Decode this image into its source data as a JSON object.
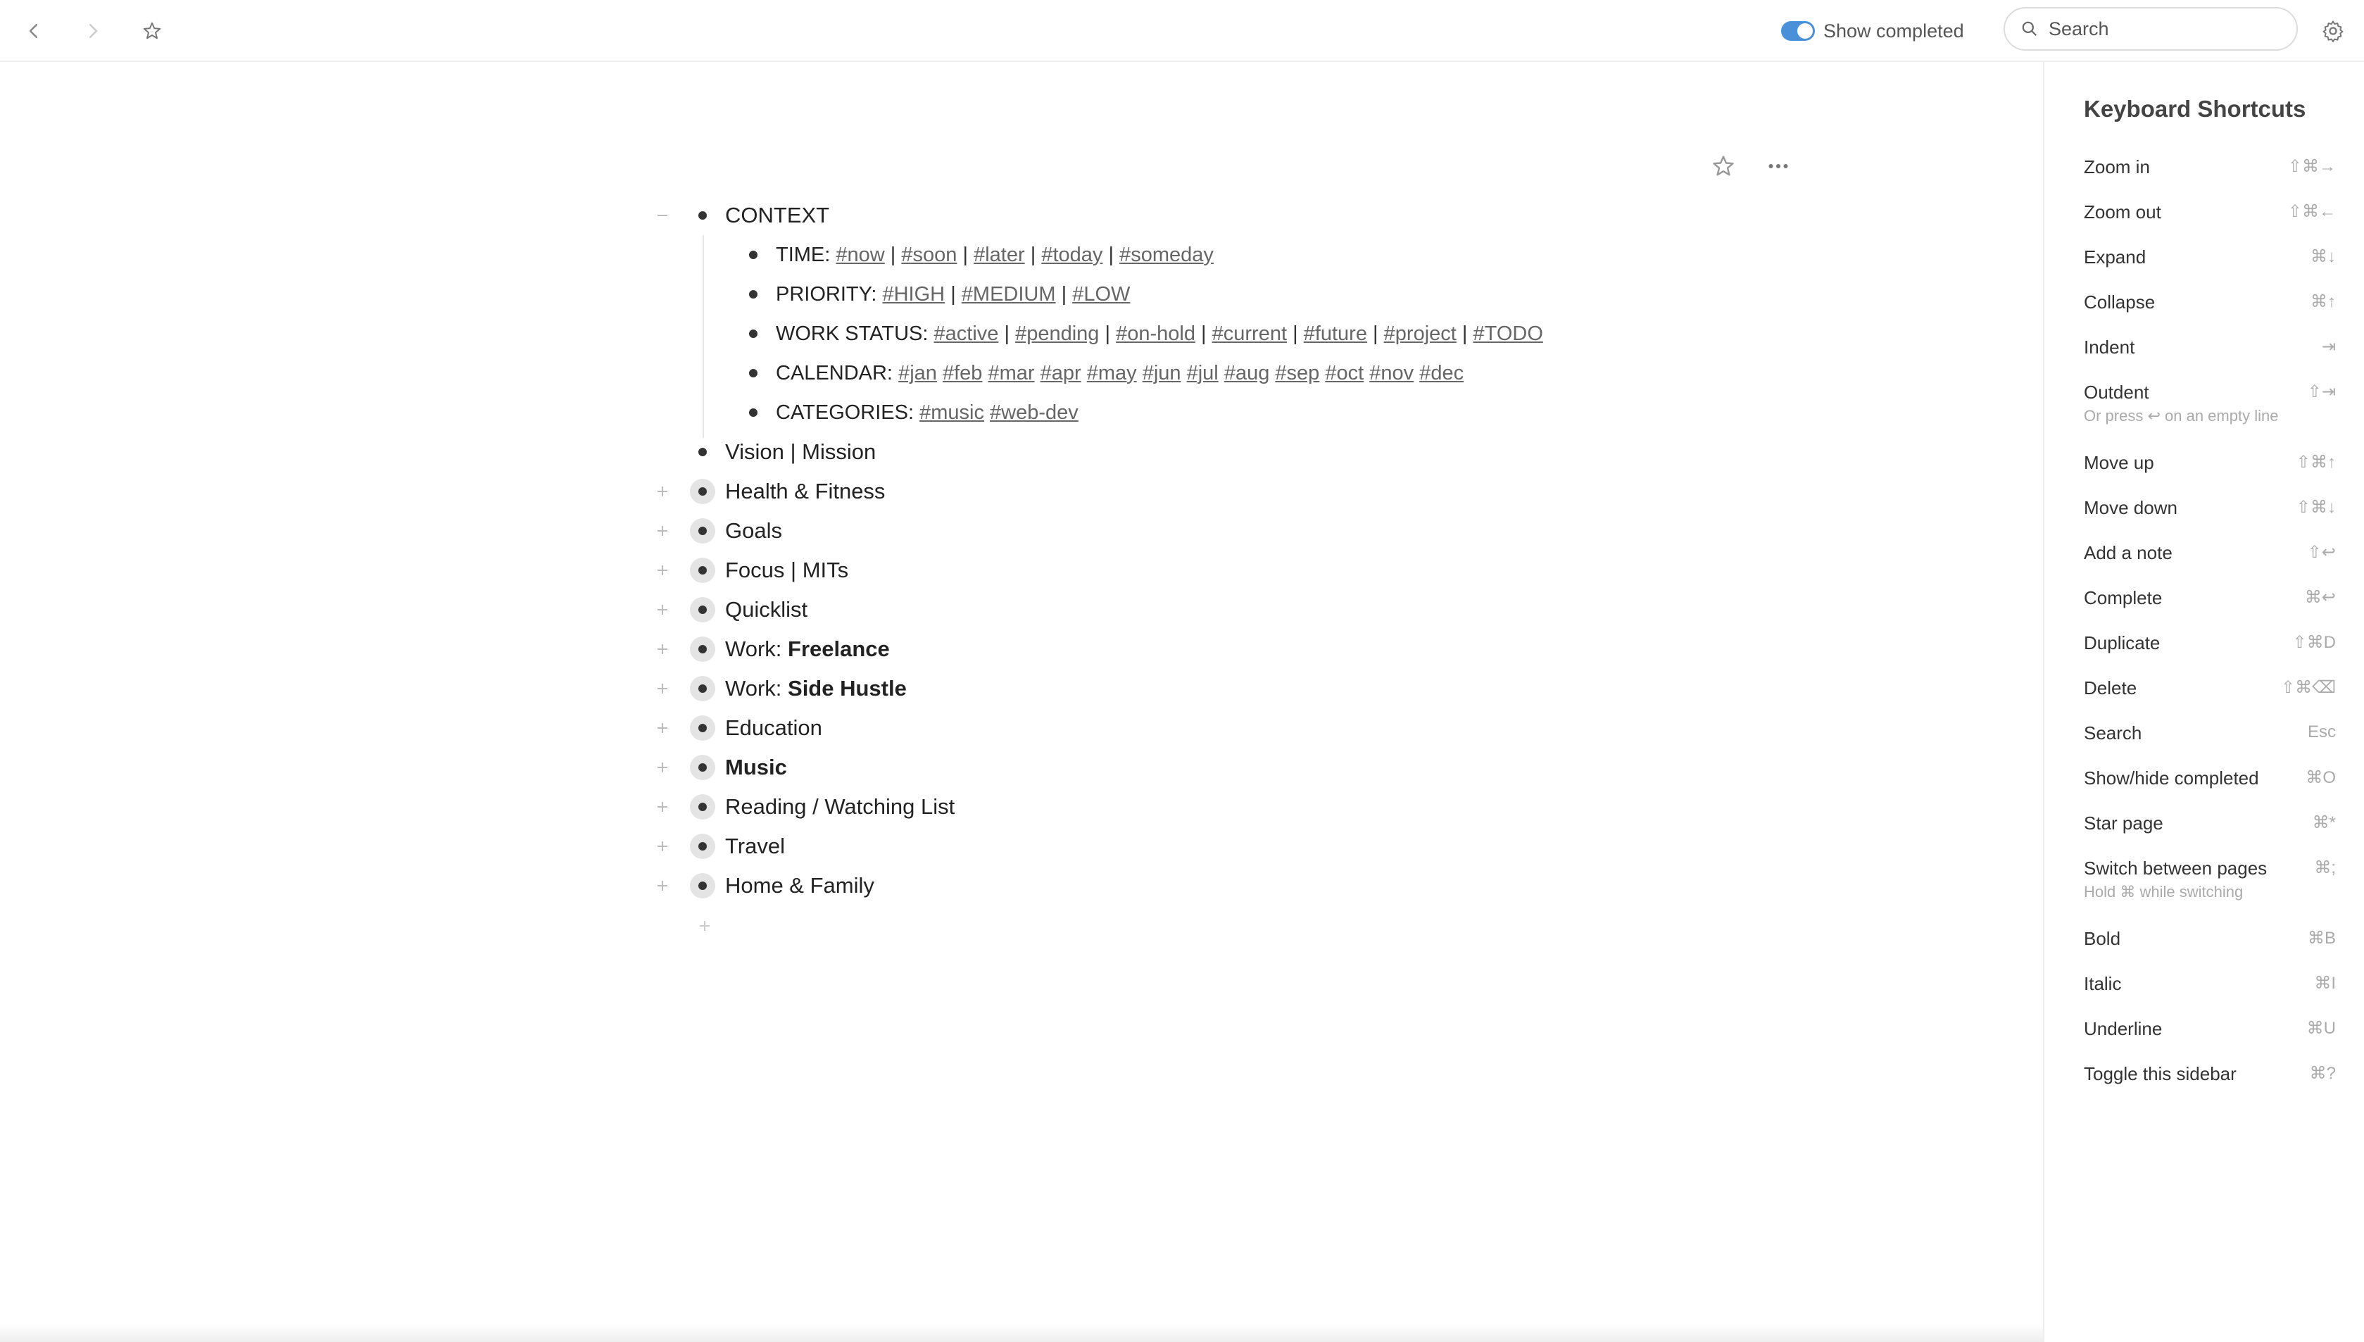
{
  "toolbar": {
    "show_completed_label": "Show completed",
    "show_completed_on": true,
    "search_placeholder": "Search",
    "accent_color": "#4a90d9"
  },
  "outline": {
    "context": {
      "title": "CONTEXT",
      "children": {
        "time": {
          "label": "TIME:",
          "tags": [
            "#now",
            "#soon",
            "#later",
            "#today",
            "#someday"
          ]
        },
        "priority": {
          "label": "PRIORITY:",
          "tags": [
            "#HIGH",
            "#MEDIUM",
            "#LOW"
          ]
        },
        "work_status": {
          "label": "WORK STATUS:",
          "tags": [
            "#active",
            "#pending",
            "#on-hold",
            "#current",
            "#future",
            "#project",
            "#TODO"
          ]
        },
        "calendar": {
          "label": "CALENDAR:",
          "tags": [
            "#jan",
            "#feb",
            "#mar",
            "#apr",
            "#may",
            "#jun",
            "#jul",
            "#aug",
            "#sep",
            "#oct",
            "#nov",
            "#dec"
          ]
        },
        "categories": {
          "label": "CATEGORIES:",
          "tags": [
            "#music",
            "#web-dev"
          ]
        }
      }
    },
    "items": {
      "vision": "Vision | Mission",
      "health": "Health & Fitness",
      "goals": "Goals",
      "focus": "Focus | MITs",
      "quicklist": "Quicklist",
      "work_prefix": "Work:",
      "freelance": "Freelance",
      "side_hustle": "Side Hustle",
      "education": "Education",
      "music": "Music",
      "reading": "Reading / Watching List",
      "travel": "Travel",
      "home": "Home & Family"
    }
  },
  "sidebar": {
    "title": "Keyboard Shortcuts",
    "shortcuts": [
      {
        "label": "Zoom in",
        "key": "⇧⌘→"
      },
      {
        "label": "Zoom out",
        "key": "⇧⌘←"
      },
      {
        "label": "Expand",
        "key": "⌘↓"
      },
      {
        "label": "Collapse",
        "key": "⌘↑"
      },
      {
        "label": "Indent",
        "key": "⇥"
      },
      {
        "label": "Outdent",
        "key": "⇧⇥",
        "hint": "Or press ↩ on an empty line"
      },
      {
        "label": "Move up",
        "key": "⇧⌘↑"
      },
      {
        "label": "Move down",
        "key": "⇧⌘↓"
      },
      {
        "label": "Add a note",
        "key": "⇧↩"
      },
      {
        "label": "Complete",
        "key": "⌘↩"
      },
      {
        "label": "Duplicate",
        "key": "⇧⌘D"
      },
      {
        "label": "Delete",
        "key": "⇧⌘⌫"
      },
      {
        "label": "Search",
        "key": "Esc"
      },
      {
        "label": "Show/hide completed",
        "key": "⌘O"
      },
      {
        "label": "Star page",
        "key": "⌘*"
      },
      {
        "label": "Switch between pages",
        "key": "⌘;",
        "hint": "Hold ⌘ while switching"
      },
      {
        "label": "Bold",
        "key": "⌘B"
      },
      {
        "label": "Italic",
        "key": "⌘I"
      },
      {
        "label": "Underline",
        "key": "⌘U"
      },
      {
        "label": "Toggle this sidebar",
        "key": "⌘?"
      }
    ]
  }
}
